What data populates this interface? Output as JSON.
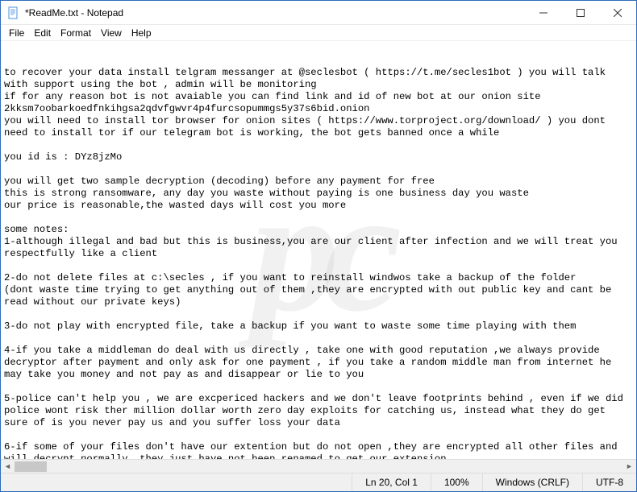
{
  "titlebar": {
    "title": "*ReadMe.txt - Notepad"
  },
  "menu": {
    "file": "File",
    "edit": "Edit",
    "format": "Format",
    "view": "View",
    "help": "Help"
  },
  "document": {
    "text": "to recover your data install telgram messanger at @seclesbot ( https://t.me/secles1bot ) you will talk with support using the bot , admin will be monitoring\nif for any reason bot is not avaiable you can find link and id of new bot at our onion site 2kksm7oobarkoedfnkihgsa2qdvfgwvr4p4furcsopummgs5y37s6bid.onion\nyou will need to install tor browser for onion sites ( https://www.torproject.org/download/ ) you dont need to install tor if our telegram bot is working, the bot gets banned once a while\n\nyou id is : DYz8jzMo\n\nyou will get two sample decryption (decoding) before any payment for free\nthis is strong ransomware, any day you waste without paying is one business day you waste\nour price is reasonable,the wasted days will cost you more\n\nsome notes:\n1-although illegal and bad but this is business,you are our client after infection and we will treat you respectfully like a client\n\n2-do not delete files at c:\\secles , if you want to reinstall windwos take a backup of the folder\n(dont waste time trying to get anything out of them ,they are encrypted with out public key and cant be read without our private keys)\n\n3-do not play with encrypted file, take a backup if you want to waste some time playing with them\n\n4-if you take a middleman do deal with us directly , take one with good reputation ,we always provide decryptor after payment and only ask for one payment , if you take a random middle man from internet he may take you money and not pay as and disappear or lie to you\n\n5-police can't help you , we are excpericed hackers and we don't leave footprints behind , even if we did police wont risk ther million dollar worth zero day exploits for catching us, instead what they do get sure of is you never pay us and you suffer loss your data\n\n6-if some of your files don't have our extention but do not open ,they are encrypted all other files and will decrypt normally ,they just have not been renamed to get our extension"
  },
  "statusbar": {
    "position": "Ln 20, Col 1",
    "zoom": "100%",
    "line_ending": "Windows (CRLF)",
    "encoding": "UTF-8"
  },
  "watermark": "pc"
}
